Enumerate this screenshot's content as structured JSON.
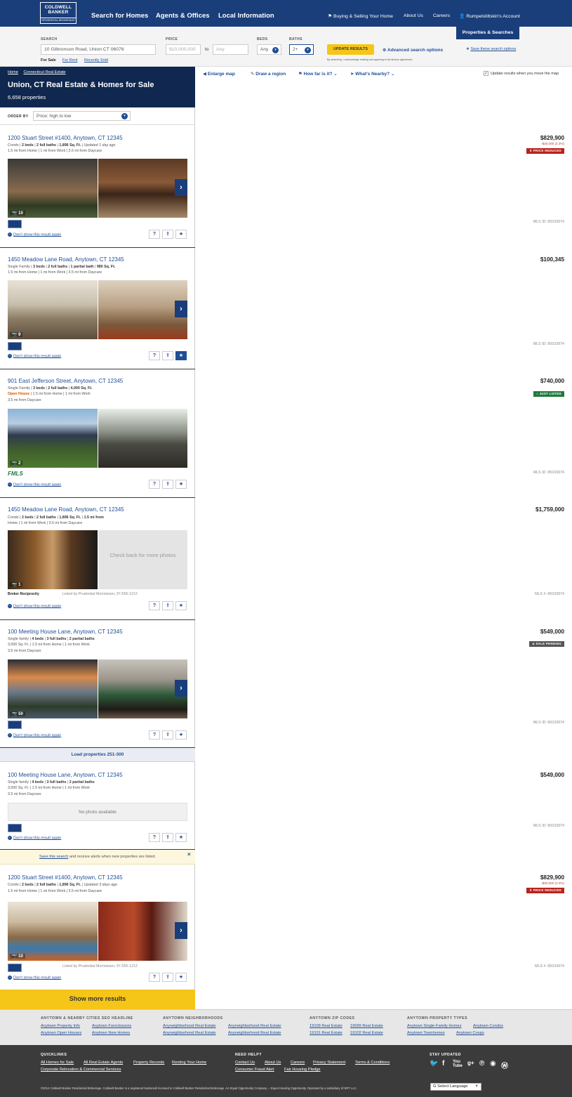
{
  "brand": {
    "logo_line1": "COLDWELL",
    "logo_line2": "BANKER",
    "logo_line3": "RESIDENTIAL BROKERAGE"
  },
  "nav": {
    "main": [
      "Search for Homes",
      "Agents & Offices",
      "Local Information"
    ],
    "buying_selling": "Buying & Selling Your Home",
    "about": "About Us",
    "careers": "Careers",
    "account": "Rumpelstiltskin's Account",
    "properties_tab": "Properties & Searches"
  },
  "search": {
    "search_label": "SEARCH",
    "search_value": "10 Gilbronson Road, Union CT 06076",
    "modes": [
      "For Sale",
      "For Rent",
      "Recently Sold"
    ],
    "price_label": "PRICE",
    "price_min_placeholder": "$10,000,000",
    "price_to": "to",
    "price_max_placeholder": "Any",
    "beds_label": "BEDS",
    "beds_value": "Any",
    "baths_label": "BATHS",
    "baths_value": "2+",
    "update_button": "UPDATE RESULTS",
    "advanced": "Advanced search options",
    "save": "Save these search options",
    "license_note": "By searching, I acknowledge reading and agreeing to the license agreement."
  },
  "map_tools": {
    "enlarge": "Enlarge map",
    "draw": "Draw a region",
    "how_far": "How far is it?",
    "nearby": "What's Nearby?",
    "update_move": "Update results when you move the map"
  },
  "header": {
    "breadcrumb": [
      "Home",
      "Connecticut Real Estate"
    ],
    "title": "Union, CT Real Estate & Homes for Sale",
    "count": "6,658 properties",
    "order_label": "ORDER BY",
    "order_value": "Price: high to low"
  },
  "listings": [
    {
      "address": "1200 Stuart Street #1400, Anytown, CT 12345",
      "price": "$829,900",
      "price_change": "-$20,000 (2.3%)",
      "tag": "PRICE REDUCED",
      "meta1": [
        "Condo",
        "2 beds",
        "2 full baths",
        "1,896 Sq. Ft.",
        "Updated 1 day ago"
      ],
      "meta2": "1.5 mi from Home | 1 mi from Work | 3.5 mi from Daycare",
      "photo_count": "10",
      "mls": "MLS ID: 89103974",
      "dont_show": "Don't show this result again"
    },
    {
      "address": "1450 Meadow Lane Road, Anytown, CT 12345",
      "price": "$100,345",
      "meta1": [
        "Single Family",
        "3 beds",
        "2 full baths",
        "1 partial bath",
        "980 Sq. Ft."
      ],
      "meta2": "1.5 mi from Home | 1 mi from Work | 3.5 mi from Daycare",
      "photo_count": "9",
      "mls": "MLS ID: 89103974",
      "dont_show": "Don't show this result again"
    },
    {
      "address": "901 East Jefferson Street, Anytown, CT 12345",
      "price": "$740,000",
      "tag": "JUST LISTED",
      "meta1": [
        "Single Family",
        "3 beds",
        "2 full baths",
        "4,000 Sq. Ft."
      ],
      "open_house": "Open House",
      "meta2": "1.5 mi from Home | 1 mi from Work",
      "meta3": "3.5 mi from Daycare",
      "photo_count": "2",
      "broker_logo": "FMLS",
      "mls": "MLS ID: 89103974",
      "dont_show": "Don't show this result again"
    },
    {
      "address": "1450 Meadow Lane Road, Anytown, CT 12345",
      "price": "$1,759,000",
      "meta1": [
        "Condo",
        "2 beds",
        "2 full baths",
        "1,896 Sq. Ft.",
        "1.5 mi from"
      ],
      "meta2": "Home | 1 mi from Work | 3.5 mi from Daycare",
      "photo_count": "1",
      "check_back": "Check back for more photos",
      "broker_logo": "Broker Reciprocity",
      "listed_by": "Listed by Prudential Morristown, 97-555-1212",
      "mls": "MLS #: 89103974",
      "dont_show": "Don't show this result again"
    },
    {
      "address": "100 Meeting House Lane, Anytown, CT 12345",
      "price": "$549,000",
      "tag": "SALE PENDING",
      "meta1": [
        "Single family",
        "4 beds",
        "3 full baths",
        "2 partial baths"
      ],
      "meta2": "3,000 Sq. Ft. | 1.5 mi from Home | 1 mi from Work",
      "meta3": "3.5 mi from Daycare",
      "photo_count": "50",
      "mls": "MLS ID: 89103974",
      "dont_show": "Don't show this result again"
    },
    {
      "address": "100 Meeting House Lane, Anytown, CT 12345",
      "price": "$549,000",
      "meta1": [
        "Single family",
        "4 beds",
        "3 full baths",
        "2 partial baths"
      ],
      "meta2": "3,000 Sq. Ft. | 1.5 mi from Home | 1 mi from Work",
      "meta3": "3.5 mi from Daycare",
      "no_photo": "No photo available",
      "mls": "MLS ID: 89103974",
      "dont_show": "Don't show this result again"
    },
    {
      "address": "1200 Stuart Street #1400, Anytown, CT 12345",
      "price": "$829,900",
      "price_change": "-$20,000 (2.3%)",
      "tag": "PRICE REDUCED",
      "meta1": [
        "Condo",
        "2 beds",
        "2 full baths",
        "1,896 Sq. Ft.",
        "Updated 3 days ago"
      ],
      "meta2": "1.5 mi from Home | 1 mi from Work | 3.5 mi from Daycare",
      "photo_count": "10",
      "listed_by": "Listed by Prudential Morristown, 97-555-1212",
      "mls": "MLS #: 89103974",
      "dont_show": "Don't show this result again"
    }
  ],
  "load_more": "Load properties 251-300",
  "alert": {
    "link": "Save this search",
    "text": " and receive alerts when new properties are listed."
  },
  "show_more": "Show more results",
  "footer_seo": {
    "col1": {
      "heading": "ANYTOWN & NEARBY CITIES SEO HEADLINE",
      "links": [
        "Anytown Property Info",
        "Anytown Foreclosures",
        "Anytown Open Houses",
        "Anytown New Homes"
      ]
    },
    "col2": {
      "heading": "ANYTOWN NEIGHBORHOODS",
      "links": [
        "Anyneighborhood Real Estate",
        "Anyneighborhood Real Estate",
        "Anyneighborhood Real Estate",
        "Anyneighborhood Real Estate"
      ]
    },
    "col3": {
      "heading": "ANYTOWN ZIP CODES",
      "links": [
        "19109 Real Estate",
        "19099 Real Estate",
        "19101 Real Estate",
        "19102 Real Estate"
      ]
    },
    "col4": {
      "heading": "ANYTOWN PROPERTY TYPES",
      "links": [
        "Anytown Single-Family Homes",
        "Anytown Condos",
        "Anytown Townhomes",
        "Anytown Coops"
      ]
    }
  },
  "footer_main": {
    "quicklinks_heading": "QUICKLINKS",
    "quicklinks": [
      "All Homes for Sale",
      "All Real Estate Agents",
      "Property Records",
      "Renting Your Home",
      "Corporate Relocation & Commercial Services"
    ],
    "help_heading": "NEED HELP?",
    "help": [
      "Contact Us",
      "About Us",
      "Careers",
      "Privacy Statement",
      "Terms & Conditions",
      "Consumer Fraud Alert",
      "Fair Housing Pledge"
    ],
    "stay_heading": "STAY UPDATED",
    "copyright": "©2014 Coldwell Banker Residential Brokerage. Coldwell Banker is a registered trademark licensed to Coldwell Banker Residential Brokerage. An Equal Opportunity Company.",
    "equal_housing": "Equal Housing Opportunity. Operated by a subsidiary of NRT LLC.",
    "language": "Select Language"
  },
  "colors": {
    "navy": "#1a3e7a",
    "dark_navy": "#10274f",
    "link": "#1f4e96",
    "yellow": "#f5c518",
    "red": "#b8231e",
    "green": "#1f7a3e"
  }
}
